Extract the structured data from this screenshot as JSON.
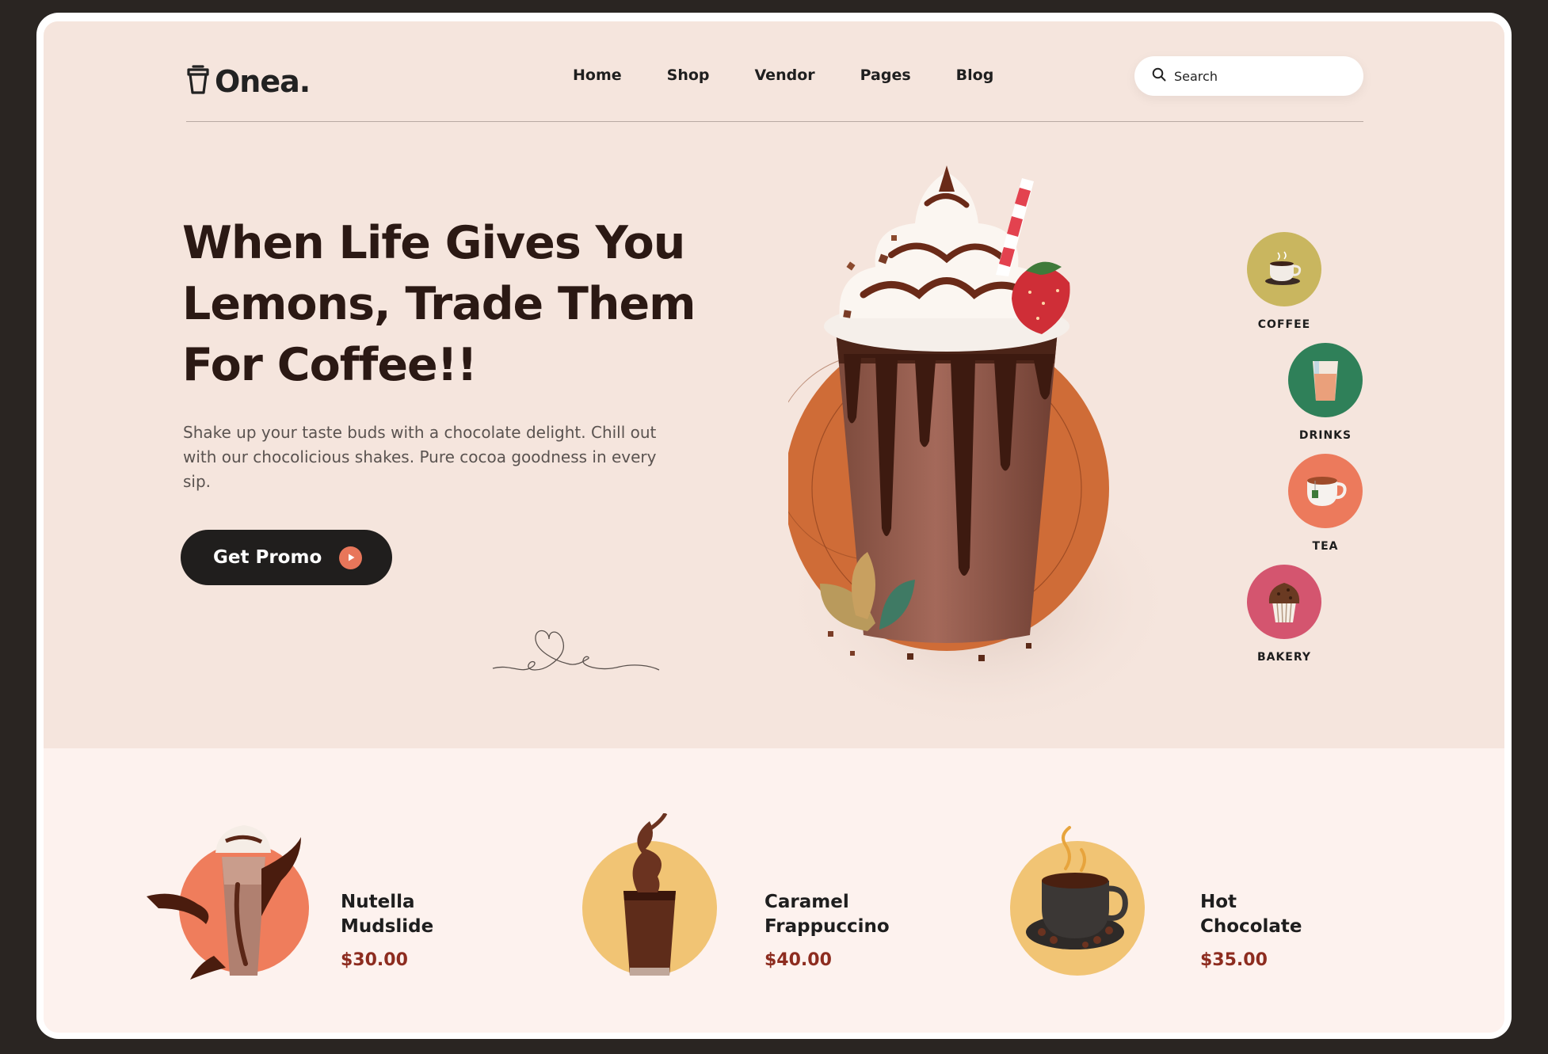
{
  "brand": {
    "name": "Onea."
  },
  "nav": {
    "items": [
      "Home",
      "Shop",
      "Vendor",
      "Pages",
      "Blog"
    ]
  },
  "search": {
    "placeholder": "Search"
  },
  "hero": {
    "headline_lines": [
      "When Life Gives You",
      "Lemons, Trade Them",
      "For Coffee!!"
    ],
    "description": "Shake up your taste buds with a chocolate delight. Chill out with our chocolicious shakes. Pure cocoa goodness in every sip.",
    "cta_label": "Get Promo"
  },
  "categories": [
    {
      "label": "COFFEE",
      "icon": "coffee-cup-icon",
      "color": "#c9b65f"
    },
    {
      "label": "DRINKS",
      "icon": "drink-glass-icon",
      "color": "#2f8059"
    },
    {
      "label": "TEA",
      "icon": "tea-cup-icon",
      "color": "#ec7a5c"
    },
    {
      "label": "BAKERY",
      "icon": "muffin-icon",
      "color": "#d4556f"
    }
  ],
  "products": [
    {
      "name_lines": [
        "Nutella",
        "Mudslide"
      ],
      "price": "$30.00",
      "circle_color": "#ef7d5c"
    },
    {
      "name_lines": [
        "Caramel",
        "Frappuccino"
      ],
      "price": "$40.00",
      "circle_color": "#f1c474"
    },
    {
      "name_lines": [
        "Hot",
        "Chocolate"
      ],
      "price": "$35.00",
      "circle_color": "#f1c474"
    }
  ],
  "colors": {
    "hero_bg": "#f5e5dd",
    "page_bg": "#fdf2ee",
    "accent": "#e8765a",
    "price": "#8d2c1f",
    "dark": "#201e1d"
  }
}
